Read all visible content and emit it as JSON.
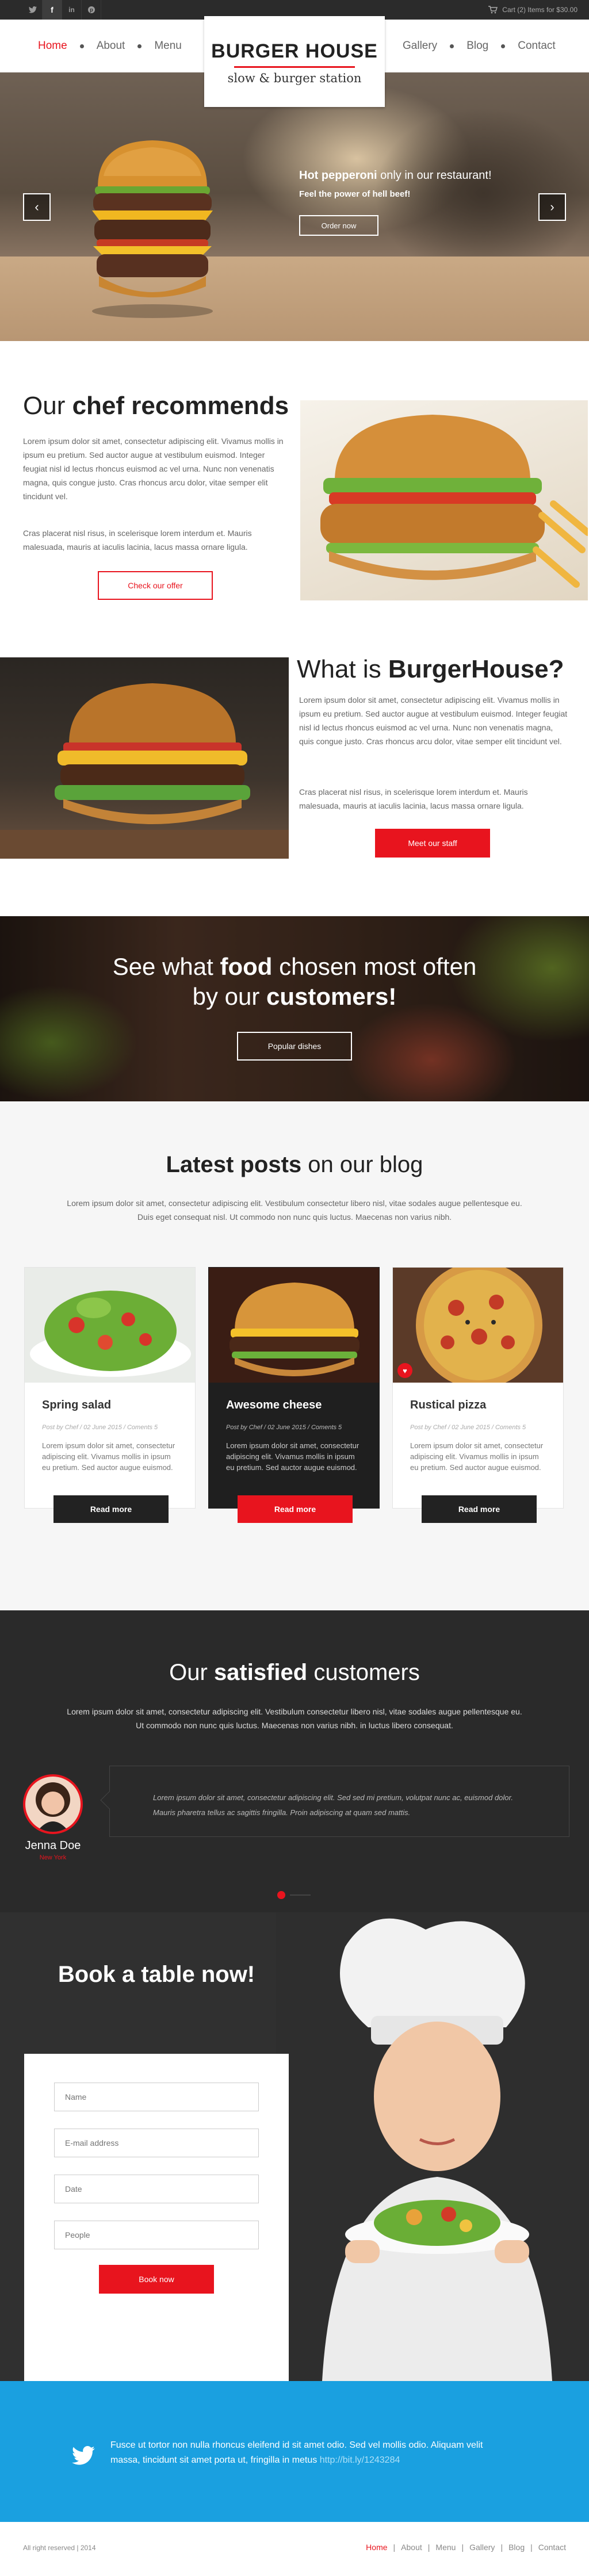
{
  "topbar": {
    "social": [
      "twitter-icon",
      "facebook-icon",
      "linkedin-icon",
      "pinterest-icon"
    ],
    "cart_text": "Cart (2) Items for $30.00"
  },
  "nav": {
    "left": [
      "Home",
      "About",
      "Menu"
    ],
    "right": [
      "Gallery",
      "Blog",
      "Contact"
    ],
    "active": "Home"
  },
  "logo": {
    "title": "BURGER HOUSE",
    "subtitle": "slow & burger station"
  },
  "hero": {
    "headline_bold": "Hot pepperoni",
    "headline_rest": " only in our restaurant!",
    "sub": "Feel the power of hell beef!",
    "button": "Order now"
  },
  "chef": {
    "title_1": "Our ",
    "title_bold": "chef recommends",
    "p1": "Lorem ipsum dolor sit amet, consectetur adipiscing elit. Vivamus mollis in ipsum eu pretium. Sed auctor augue at vestibulum euismod. Integer feugiat nisl id lectus rhoncus euismod ac vel urna. Nunc non venenatis magna, quis congue justo. Cras rhoncus arcu dolor, vitae semper elit tincidunt vel.",
    "p2": "Cras placerat nisl risus, in scelerisque lorem interdum et. Mauris malesuada, mauris at iaculis lacinia, lacus massa ornare ligula.",
    "button": "Check our offer"
  },
  "about": {
    "title_1": "What is ",
    "title_bold": "BurgerHouse?",
    "p1": "Lorem ipsum dolor sit amet, consectetur adipiscing elit. Vivamus mollis in ipsum eu pretium. Sed auctor augue at vestibulum euismod. Integer feugiat nisl id lectus rhoncus euismod ac vel urna. Nunc non venenatis magna, quis congue justo. Cras rhoncus arcu dolor, vitae semper elit tincidunt vel.",
    "p2": "Cras placerat nisl risus, in scelerisque lorem interdum et. Mauris malesuada, mauris at iaculis lacinia, lacus massa ornare ligula.",
    "button": "Meet our staff"
  },
  "popular": {
    "line1_a": "See what ",
    "line1_b": "food",
    "line1_c": " chosen most often",
    "line2_a": "by our ",
    "line2_b": "customers!",
    "button": "Popular dishes"
  },
  "blog": {
    "title_bold": "Latest posts",
    "title_rest": " on our blog",
    "intro1": "Lorem ipsum dolor sit amet, consectetur adipiscing elit. Vestibulum consectetur libero nisl, vitae sodales augue pellentesque eu.",
    "intro2": "Duis eget consequat nisl. Ut commodo non nunc quis luctus. Maecenas non varius nibh.",
    "posts": [
      {
        "title": "Spring salad",
        "meta": "Post by Chef / 02 June 2015 / Coments 5",
        "excerpt": "Lorem ipsum dolor sit amet, consectetur adipiscing elit. Vivamus mollis in ipsum eu pretium. Sed auctor augue euismod.",
        "button": "Read more"
      },
      {
        "title": "Awesome cheese",
        "meta": "Post by Chef / 02 June 2015 / Coments 5",
        "excerpt": "Lorem ipsum dolor sit amet, consectetur adipiscing elit. Vivamus mollis in ipsum eu pretium. Sed auctor augue euismod.",
        "button": "Read more"
      },
      {
        "title": "Rustical pizza",
        "meta": "Post by Chef / 02 June 2015 / Coments 5",
        "excerpt": "Lorem ipsum dolor sit amet, consectetur adipiscing elit. Vivamus mollis in ipsum eu pretium. Sed auctor augue euismod.",
        "button": "Read more"
      }
    ]
  },
  "testimonials": {
    "title_1": "Our ",
    "title_bold": "satisfied",
    "title_2": " customers",
    "intro1": "Lorem ipsum dolor sit amet, consectetur adipiscing elit. Vestibulum consectetur libero nisl, vitae sodales augue pellentesque eu.",
    "intro2": "Ut commodo non nunc quis luctus. Maecenas non varius nibh. in luctus libero consequat.",
    "name": "Jenna Doe",
    "city": "New York",
    "quote1": "Lorem ipsum dolor sit amet, consectetur adipiscing elit. Sed sed mi pretium, volutpat nunc ac, euismod dolor.",
    "quote2": "Mauris pharetra tellus ac sagittis fringilla. Proin adipiscing at quam sed mattis."
  },
  "booking": {
    "title": "Book a table now!",
    "fields": [
      "Name",
      "E-mail address",
      "Date",
      "People"
    ],
    "button": "Book now"
  },
  "tweet": {
    "line1": "Fusce ut tortor non nulla rhoncus eleifend id sit amet odio. Sed vel mollis odio. Aliquam velit",
    "line2": "massa, tincidunt sit amet porta ut, fringilla in metus",
    "link": "http://bit.ly/1243284"
  },
  "footer": {
    "copyright": "All right reserved | 2014",
    "links": [
      "Home",
      "About",
      "Menu",
      "Gallery",
      "Blog",
      "Contact"
    ]
  },
  "colors": {
    "accent": "#e8141e",
    "dark": "#2a2a2a",
    "twitter_blue": "#1aa0e0"
  }
}
